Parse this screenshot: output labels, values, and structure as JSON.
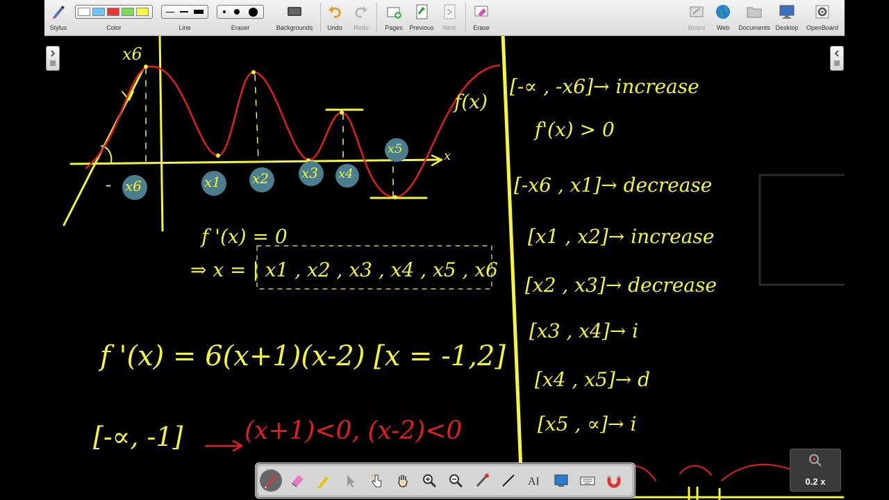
{
  "toolbar": {
    "stylus": "Stylus",
    "color": "Color",
    "line": "Line",
    "eraser": "Eraser",
    "backgrounds": "Backgrounds",
    "undo": "Undo",
    "redo": "Redo",
    "pages": "Pages",
    "previous": "Previous",
    "next": "Next",
    "erase": "Erase",
    "board": "Board",
    "web": "Web",
    "documents": "Documents",
    "desktop": "Desktop",
    "openboard": "OpenBoard",
    "colors": [
      "#ffffff",
      "#6ec6ff",
      "#e53935",
      "#7ed957",
      "#f5f542"
    ]
  },
  "board": {
    "ink_yellow": "#f5f53a",
    "ink_red": "#e02020",
    "marker_blue": "#4b7f8f",
    "graph": {
      "fx": "f(x)",
      "x_axis": "x",
      "neg_x6": "- x6",
      "x6_label": "x6",
      "points": [
        "x6",
        "x1",
        "x2",
        "x3",
        "x4",
        "x5"
      ]
    },
    "derivative_zero": "f '(x) = 0",
    "solution": "⇒ x = | x1 , x2 , x3 , x4 , x5 , x6",
    "derivative_formula": "f '(x) = 6(x+1)(x-2) [x = -1,2]",
    "interval_bracket": "[-∝, -1]",
    "interval_condition": "(x+1)<0, (x-2)<0",
    "intervals": [
      {
        "range": "[-∝ , -x6]",
        "result": "→ increase"
      },
      {
        "range": "f'(x) > 0",
        "result": ""
      },
      {
        "range": "[-x6 , x1]",
        "result": "→ decrease"
      },
      {
        "range": "[x1 , x2]",
        "result": "→ increase"
      },
      {
        "range": "[x2 , x3]",
        "result": "→ decrease"
      },
      {
        "range": "[x3 , x4]",
        "result": "→  i"
      },
      {
        "range": "[x4 , x5]",
        "result": "→ d"
      },
      {
        "range": "[x5 , ∝]",
        "result": "→ i"
      }
    ]
  },
  "zoom": {
    "value": "0.2 x"
  }
}
